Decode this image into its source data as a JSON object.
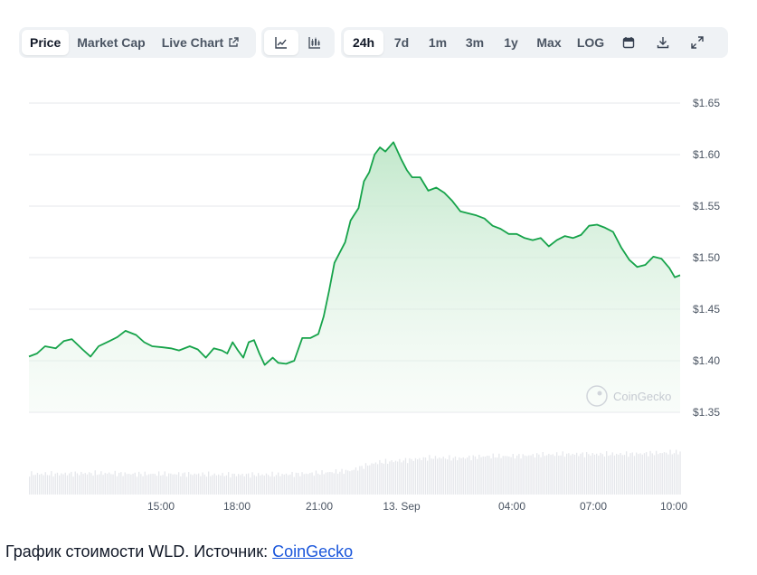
{
  "toolbar": {
    "metric_tabs": [
      {
        "label": "Price",
        "active": true
      },
      {
        "label": "Market Cap",
        "active": false
      },
      {
        "label": "Live Chart",
        "active": false
      }
    ],
    "chart_type_icons": [
      "line-chart-icon",
      "candlestick-chart-icon"
    ],
    "ranges": [
      {
        "label": "24h",
        "active": true
      },
      {
        "label": "7d",
        "active": false
      },
      {
        "label": "1m",
        "active": false
      },
      {
        "label": "3m",
        "active": false
      },
      {
        "label": "1y",
        "active": false
      },
      {
        "label": "Max",
        "active": false
      },
      {
        "label": "LOG",
        "active": false
      }
    ],
    "tool_icons": [
      "calendar-icon",
      "download-icon",
      "expand-icon"
    ]
  },
  "watermark": "CoinGecko",
  "caption": {
    "text": "График стоимости WLD. Источник: ",
    "link": "CoinGecko"
  },
  "colors": {
    "line": "#16a34a",
    "fill_top": "#bfe7c9",
    "volume": "#e5e7eb",
    "grid": "#e5e7eb",
    "axis_text": "#4b5563"
  },
  "chart_data": {
    "type": "area",
    "title": "",
    "xlabel": "",
    "ylabel": "",
    "x_ticks": [
      "15:00",
      "18:00",
      "21:00",
      "13. Sep",
      "04:00",
      "07:00",
      "10:00"
    ],
    "y_ticks": [
      "$1.35",
      "$1.40",
      "$1.45",
      "$1.50",
      "$1.55",
      "$1.60",
      "$1.65"
    ],
    "ylim": [
      1.35,
      1.65
    ],
    "xlim_hours": [
      0,
      24.3
    ],
    "grid": true,
    "series": [
      {
        "name": "",
        "x_hours": [
          0,
          0.3,
          0.6,
          1.0,
          1.3,
          1.6,
          2.0,
          2.3,
          2.6,
          3.0,
          3.3,
          3.6,
          4.0,
          4.3,
          4.6,
          5.0,
          5.3,
          5.6,
          6.0,
          6.3,
          6.6,
          6.9,
          7.2,
          7.4,
          7.6,
          7.8,
          8.0,
          8.2,
          8.4,
          8.6,
          8.8,
          9.1,
          9.3,
          9.6,
          9.9,
          10.2,
          10.5,
          10.8,
          11.0,
          11.2,
          11.4,
          11.6,
          11.8,
          12.0,
          12.1,
          12.3,
          12.5,
          12.7,
          12.9,
          13.1,
          13.3,
          13.6,
          13.9,
          14.1,
          14.3,
          14.6,
          14.9,
          15.2,
          15.5,
          15.8,
          16.1,
          16.4,
          16.7,
          17.0,
          17.3,
          17.6,
          17.9,
          18.2,
          18.5,
          18.8,
          19.1,
          19.4,
          19.7,
          20.0,
          20.3,
          20.6,
          20.9,
          21.2,
          21.5,
          21.8,
          22.1,
          22.4,
          22.7,
          23.0,
          23.3,
          23.6,
          23.9,
          24.1,
          24.3
        ],
        "values": [
          1.404,
          1.407,
          1.414,
          1.412,
          1.419,
          1.421,
          1.411,
          1.404,
          1.414,
          1.419,
          1.423,
          1.429,
          1.425,
          1.418,
          1.414,
          1.413,
          1.412,
          1.41,
          1.414,
          1.411,
          1.403,
          1.412,
          1.41,
          1.407,
          1.418,
          1.41,
          1.403,
          1.418,
          1.42,
          1.407,
          1.396,
          1.403,
          1.398,
          1.397,
          1.4,
          1.422,
          1.422,
          1.426,
          1.443,
          1.468,
          1.495,
          1.505,
          1.515,
          1.536,
          1.54,
          1.548,
          1.574,
          1.583,
          1.6,
          1.607,
          1.603,
          1.612,
          1.595,
          1.585,
          1.578,
          1.578,
          1.565,
          1.568,
          1.563,
          1.555,
          1.545,
          1.543,
          1.541,
          1.538,
          1.531,
          1.528,
          1.523,
          1.523,
          1.519,
          1.517,
          1.519,
          1.511,
          1.517,
          1.521,
          1.519,
          1.522,
          1.531,
          1.532,
          1.529,
          1.525,
          1.51,
          1.498,
          1.491,
          1.493,
          1.501,
          1.499,
          1.49,
          1.481,
          1.483
        ]
      }
    ],
    "volume": {
      "x_hours": [
        0,
        1,
        2,
        3,
        4,
        5,
        6,
        7,
        8,
        9,
        10,
        11,
        12,
        12.5,
        13,
        14,
        15,
        16,
        17,
        18,
        19,
        20,
        21,
        22,
        23,
        24.3
      ],
      "relative_values": [
        0.3,
        0.3,
        0.31,
        0.31,
        0.3,
        0.3,
        0.3,
        0.29,
        0.29,
        0.29,
        0.3,
        0.32,
        0.35,
        0.42,
        0.47,
        0.5,
        0.54,
        0.53,
        0.56,
        0.56,
        0.58,
        0.59,
        0.59,
        0.59,
        0.6,
        0.62
      ]
    }
  }
}
